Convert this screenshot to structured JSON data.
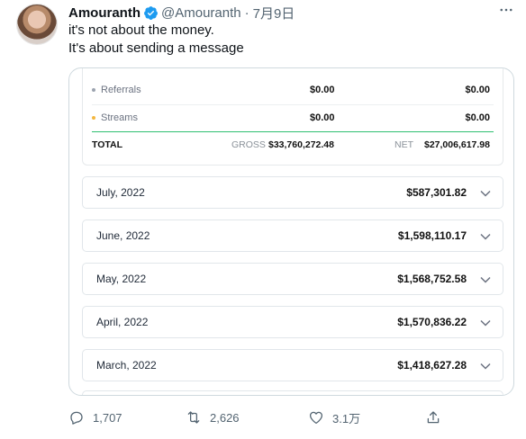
{
  "author": {
    "name": "Amouranth",
    "handle": "@Amouranth",
    "date": "7月9日"
  },
  "tweet_lines": [
    "it's not about the money.",
    "It's about sending a message"
  ],
  "earnings": {
    "rows": [
      {
        "label": "Referrals",
        "value_mid": "$0.00",
        "value_right": "$0.00",
        "bullet_color": "#9ca3af"
      },
      {
        "label": "Streams",
        "value_mid": "$0.00",
        "value_right": "$0.00",
        "bullet_color": "#f4b740"
      }
    ],
    "total": {
      "label": "TOTAL",
      "gross_label": "GROSS",
      "gross_value": "$33,760,272.48",
      "net_label": "NET",
      "net_value": "$27,006,617.98"
    },
    "months": [
      {
        "label": "July, 2022",
        "value": "$587,301.82"
      },
      {
        "label": "June, 2022",
        "value": "$1,598,110.17"
      },
      {
        "label": "May, 2022",
        "value": "$1,568,752.58"
      },
      {
        "label": "April, 2022",
        "value": "$1,570,836.22"
      },
      {
        "label": "March, 2022",
        "value": "$1,418,627.28"
      }
    ]
  },
  "actions": {
    "replies": "1,707",
    "retweets": "2,626",
    "likes": "3.1万"
  },
  "colors": {
    "verified": "#1d9bf0",
    "accent_line": "#2fbf71",
    "muted": "#536471"
  },
  "icons": [
    "more-icon",
    "verified-icon",
    "reply-icon",
    "retweet-icon",
    "like-icon",
    "share-icon",
    "chevron-down-icon"
  ]
}
